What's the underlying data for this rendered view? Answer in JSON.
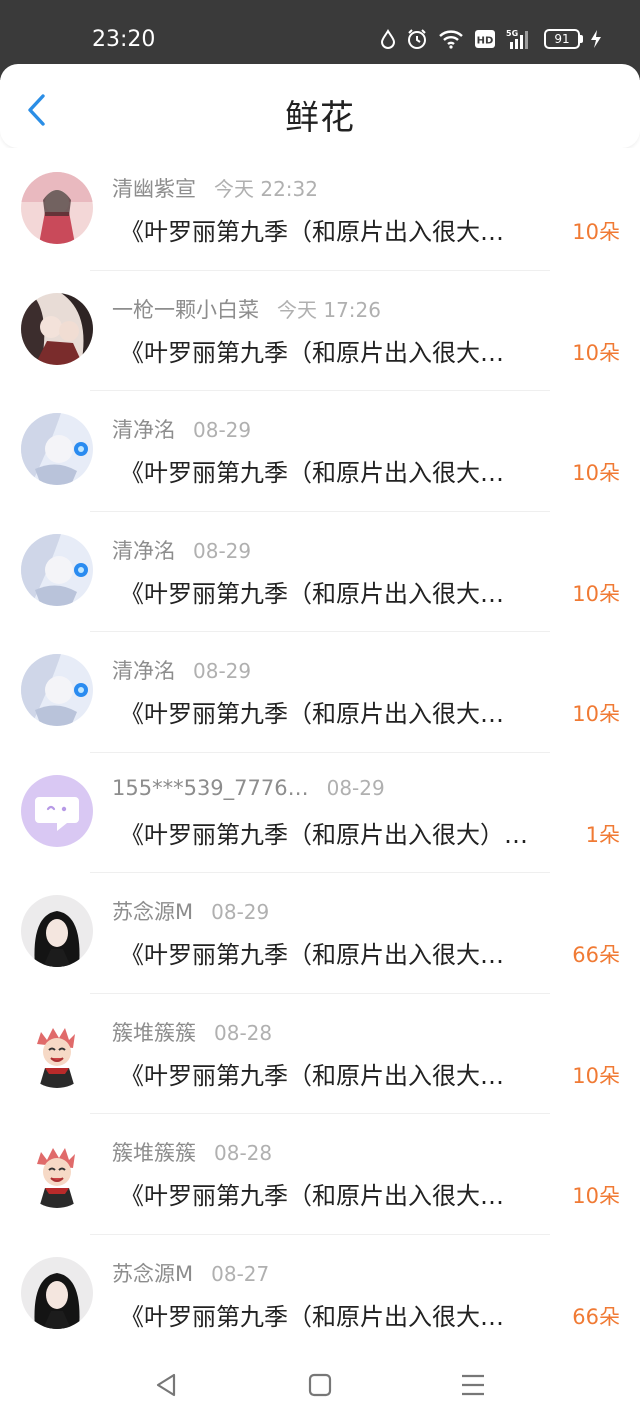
{
  "status_bar": {
    "time": "23:20",
    "battery": "91",
    "icons": [
      "drop-icon",
      "alarm-icon",
      "wifi-icon",
      "hd-icon",
      "signal-5g-icon",
      "battery-icon",
      "charging-icon"
    ]
  },
  "header": {
    "title": "鲜花",
    "back_icon": "chevron-left-icon",
    "accent_color": "#2b8ee6"
  },
  "items": [
    {
      "name": "清幽紫宣",
      "time": "今天 22:32",
      "message": "《叶罗丽第九季（和原片出入很大…",
      "count": "10朵"
    },
    {
      "name": "一枪一颗小白菜",
      "time": "今天 17:26",
      "message": "《叶罗丽第九季（和原片出入很大…",
      "count": "10朵"
    },
    {
      "name": "清净洺",
      "time": "08-29",
      "message": "《叶罗丽第九季（和原片出入很大…",
      "count": "10朵"
    },
    {
      "name": "清净洺",
      "time": "08-29",
      "message": "《叶罗丽第九季（和原片出入很大…",
      "count": "10朵"
    },
    {
      "name": "清净洺",
      "time": "08-29",
      "message": "《叶罗丽第九季（和原片出入很大…",
      "count": "10朵"
    },
    {
      "name": "155***539_7776…",
      "time": "08-29",
      "message": "《叶罗丽第九季（和原片出入很大）…",
      "count": "1朵"
    },
    {
      "name": "苏念源M",
      "time": "08-29",
      "message": "《叶罗丽第九季（和原片出入很大…",
      "count": "66朵"
    },
    {
      "name": "簇堆簇簇",
      "time": "08-28",
      "message": "《叶罗丽第九季（和原片出入很大…",
      "count": "10朵"
    },
    {
      "name": "簇堆簇簇",
      "time": "08-28",
      "message": "《叶罗丽第九季（和原片出入很大…",
      "count": "10朵"
    },
    {
      "name": "苏念源M",
      "time": "08-27",
      "message": "《叶罗丽第九季（和原片出入很大…",
      "count": "66朵"
    }
  ],
  "bottom_nav": {
    "icons": [
      "back-triangle-icon",
      "home-square-icon",
      "menu-lines-icon"
    ]
  },
  "colors": {
    "count": "#f07a34",
    "name": "#8d8d8d",
    "status_bar": "#3a3a3a"
  }
}
